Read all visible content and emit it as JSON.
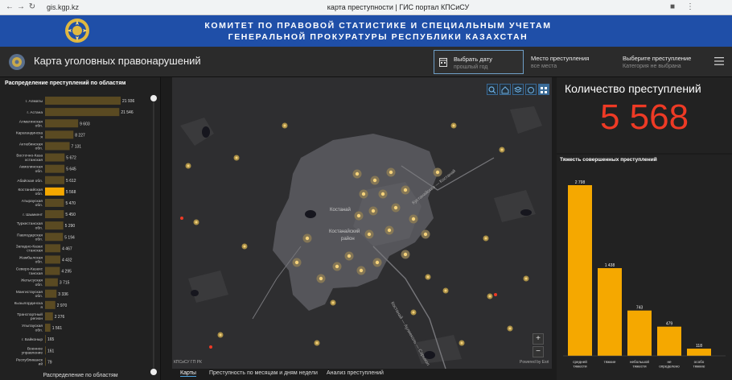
{
  "browser": {
    "url": "gis.kgp.kz",
    "page_title": "карта преступности | ГИС портал КПСиСУ"
  },
  "banner": {
    "line1": "КОМИТЕТ ПО ПРАВОВОЙ СТАТИСТИКЕ И СПЕЦИАЛЬНЫМ УЧЕТАМ",
    "line2": "ГЕНЕРАЛЬНОЙ ПРОКУРАТУРЫ РЕСПУБЛИКИ КАЗАХСТАН"
  },
  "header": {
    "title": "Карта уголовных правонарушений",
    "filters": [
      {
        "title": "Выбрать дату",
        "subtitle": "прошлый год"
      },
      {
        "title": "Место преступления",
        "subtitle": "все места"
      },
      {
        "title": "Выберите преступление",
        "subtitle": "Категория не выбрана"
      }
    ]
  },
  "left": {
    "title": "Распределение преступлений по областям",
    "footer": "Распределение по областям"
  },
  "count": {
    "title": "Количество преступлений",
    "value": "5 568"
  },
  "severity": {
    "title": "Тяжесть совершенных преступлений"
  },
  "map": {
    "attribution_left": "КПСиСУ ГП РК",
    "attribution_right": "Powered by Esri",
    "zoom_in": "+",
    "zoom_out": "−",
    "labels": [
      {
        "id": "city1",
        "text": "Костанай"
      },
      {
        "id": "city2",
        "text": "Костанайский"
      },
      {
        "id": "city3",
        "text": "район"
      },
      {
        "id": "road1",
        "text": "Кустанайская — Костанай"
      },
      {
        "id": "road2",
        "text": "Костанай — Аулиеколь — Сарыкол"
      }
    ]
  },
  "tabs": [
    "Карты",
    "Преступность по месяцам и дням недели",
    "Анализ преступлений"
  ],
  "colors": {
    "accent": "#f5a800",
    "bar_dim": "#5a4a22",
    "count_red": "#ee3a25",
    "banner_blue": "#1f4fa8"
  },
  "chart_data": [
    {
      "type": "bar",
      "orientation": "horizontal",
      "title": "Распределение преступлений по областям",
      "categories": [
        "г. Алматы",
        "г. Астана",
        "Алматинская обл.",
        "Карагандинская обл.",
        "Актюбинская обл.",
        "Восточно-Казахстанская обл.",
        "Акмолинская обл.",
        "Абайская обл.",
        "Костанайская обл.",
        "Атырауская обл.",
        "г. Шымкент",
        "Туркестанская обл.",
        "Павлодарская обл.",
        "Западно-Казахстанская обл.",
        "Жамбылская обл.",
        "Северо-Казахстанская обл.",
        "Жетысуская обл.",
        "Мангистауская обл.",
        "Кызылординская обл.",
        "Транспортный регион",
        "Улытауская обл.",
        "г. Байконыр",
        "Военное управление",
        "Республиканский уровень"
      ],
      "labels": [
        "21 936",
        "21 546",
        "9 603",
        "8 227",
        "7 131",
        "5 672",
        "5 645",
        "5 612",
        "5 568",
        "5 470",
        "5 450",
        "5 290",
        "5 194",
        "4 467",
        "4 432",
        "4 295",
        "3 715",
        "3 336",
        "2 970",
        "2 276",
        "1 561",
        "165",
        "161",
        "79"
      ],
      "values": [
        21936,
        21546,
        9603,
        8227,
        7131,
        5672,
        5645,
        5612,
        5568,
        5470,
        5450,
        5290,
        5194,
        4467,
        4432,
        4295,
        3715,
        3336,
        2970,
        2276,
        1561,
        165,
        161,
        79
      ],
      "highlight_index": 8
    },
    {
      "type": "bar",
      "title": "Тяжесть совершенных преступлений",
      "categories": [
        "средней тяжести",
        "тяжкие",
        "небольшой тяжести",
        "не определено",
        "особо тяжкие"
      ],
      "labels": [
        "2 798",
        "1 438",
        "743",
        "479",
        "118"
      ],
      "values": [
        2798,
        1438,
        743,
        479,
        118
      ]
    }
  ]
}
